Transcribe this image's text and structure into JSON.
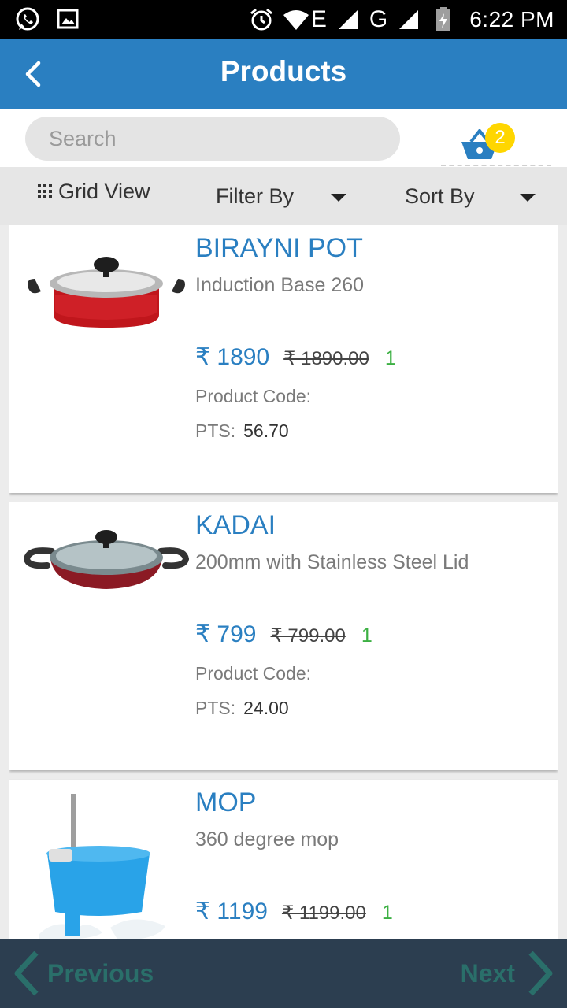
{
  "status_bar": {
    "time": "6:22 PM",
    "network_labels": [
      "E",
      "G"
    ],
    "icons": [
      "whatsapp-icon",
      "image-icon",
      "alarm-icon",
      "wifi-icon",
      "signal-icon",
      "battery-icon"
    ]
  },
  "app_bar": {
    "title": "Products",
    "back_icon": "chevron-left-icon"
  },
  "search": {
    "placeholder": "Search",
    "value": ""
  },
  "cart": {
    "icon": "basket-icon",
    "count": "2",
    "badge_color": "#ffd600"
  },
  "toolbar": {
    "grid_view_label": "Grid View",
    "filter_label": "Filter By",
    "sort_label": "Sort By"
  },
  "products": [
    {
      "name": "BIRAYNI POT",
      "description": "Induction Base 260",
      "price": "₹ 1890",
      "mrp": "₹ 1890.00",
      "qty": "1",
      "code_label": "Product Code:",
      "pts_label": "PTS:",
      "pts_value": "56.70"
    },
    {
      "name": "KADAI",
      "description": "200mm with Stainless Steel Lid",
      "price": "₹ 799",
      "mrp": "₹ 799.00",
      "qty": "1",
      "code_label": "Product Code:",
      "pts_label": "PTS:",
      "pts_value": "24.00"
    },
    {
      "name": "MOP",
      "description": "360 degree mop",
      "price": "₹ 1199",
      "mrp": "₹ 1199.00",
      "qty": "1"
    }
  ],
  "pagination": {
    "previous_label": "Previous",
    "next_label": "Next"
  },
  "colors": {
    "primary": "#2a7fc1",
    "qty_green": "#3cb043",
    "bottom_bar": "#2c3e50",
    "nav_text": "#2a6f6a"
  }
}
